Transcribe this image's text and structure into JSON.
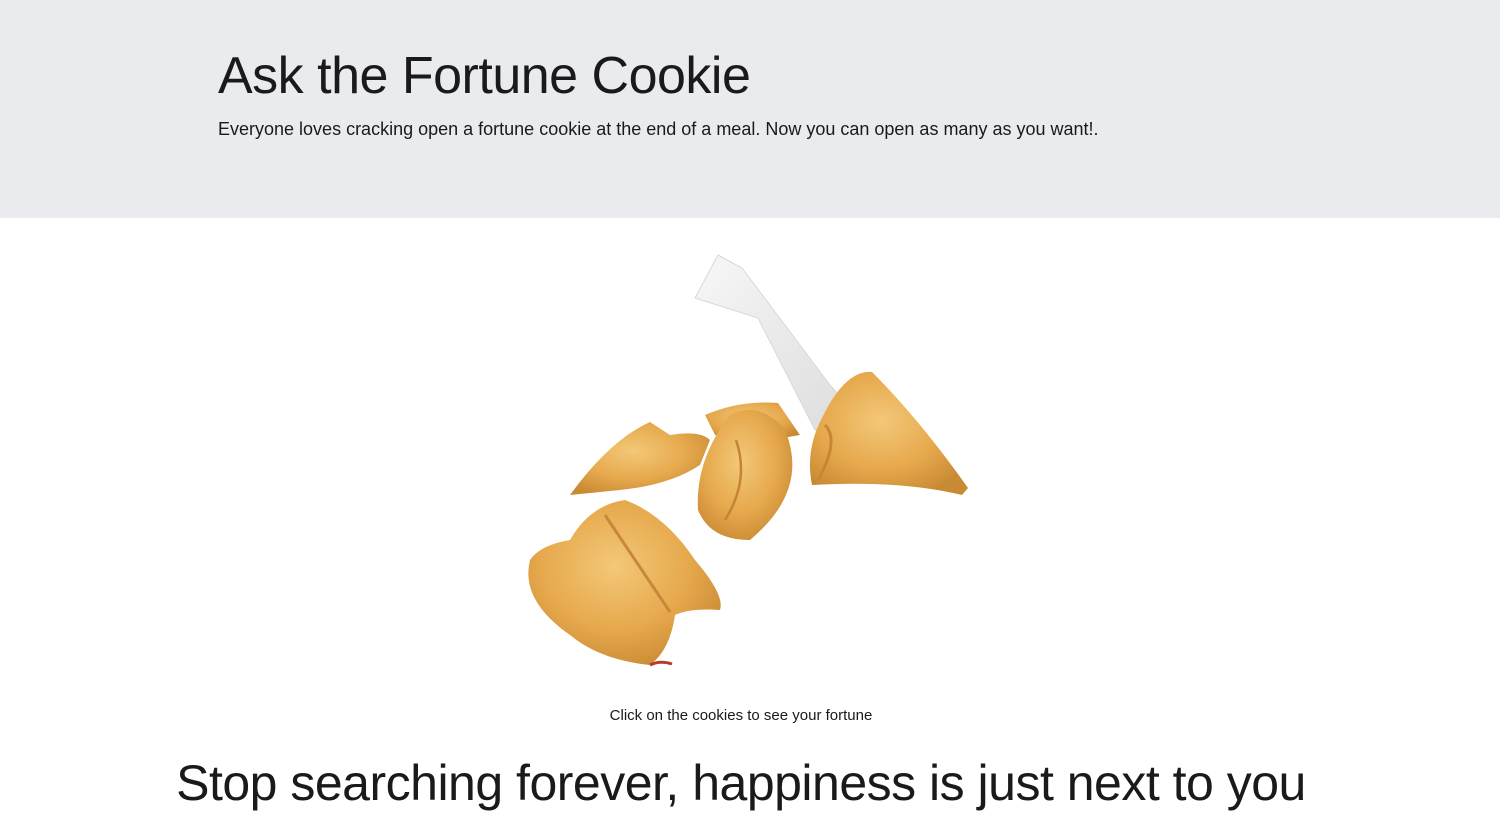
{
  "header": {
    "title": "Ask the Fortune Cookie",
    "lead": "Everyone loves cracking open a fortune cookie at the end of a meal. Now you can open as many as you want!."
  },
  "cookies": {
    "icon": "fortune-cookies-image"
  },
  "hint": "Click on the cookies to see your fortune",
  "fortune": "Stop searching forever, happiness is just next to you",
  "colors": {
    "header_bg": "#e9ebee",
    "cookie": "#e5a84b",
    "paper": "#f2f2f2"
  }
}
